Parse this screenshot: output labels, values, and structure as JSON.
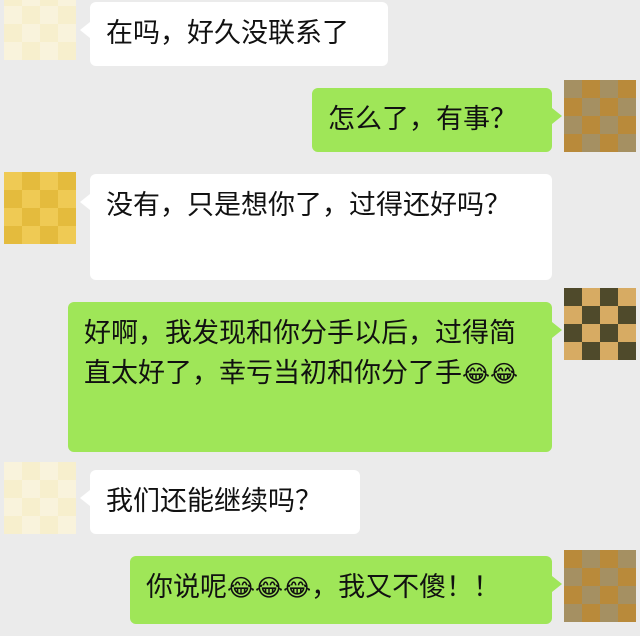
{
  "colors": {
    "background": "#ebebeb",
    "incoming_bubble": "#ffffff",
    "outgoing_bubble": "#9fe658"
  },
  "messages": [
    {
      "side": "incoming",
      "text": "在吗，好久没联系了"
    },
    {
      "side": "outgoing",
      "text": "怎么了，有事？"
    },
    {
      "side": "incoming",
      "text": "没有，只是想你了，过得还好吗？"
    },
    {
      "side": "outgoing",
      "text": "好啊，我发现和你分手以后，过得简直太好了，幸亏当初和你分了手",
      "emoji": "😂😂"
    },
    {
      "side": "incoming",
      "text": "我们还能继续吗？"
    },
    {
      "side": "outgoing",
      "text": "你说呢",
      "emoji": "😂😂😂",
      "text_after": "，我又不傻！！"
    }
  ],
  "avatars": {
    "contact": "blurred-avatar",
    "self": "blurred-avatar"
  }
}
